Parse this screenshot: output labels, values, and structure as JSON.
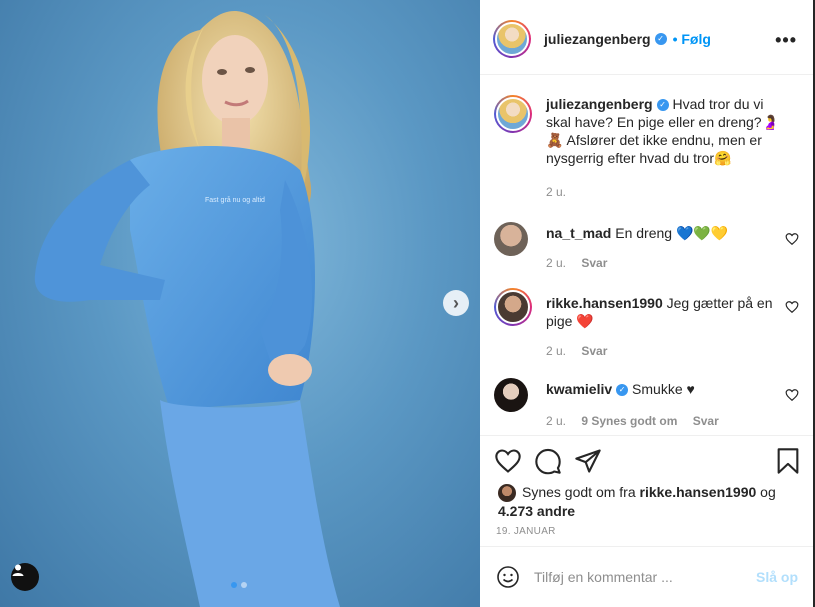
{
  "post": {
    "author": "juliezangenberg",
    "follow_label": "Følg",
    "more_icon": "•••",
    "caption": "Hvad tror du vi skal have? En pige eller en dreng?🤰🧸 Afslører det ikke endnu, men er nysgerrig efter hvad du tror🤗",
    "caption_time": "2 u.",
    "image_dots": {
      "total": 2,
      "active": 1
    }
  },
  "comments": [
    {
      "user": "na_t_mad",
      "text": "En dreng 💙💚💛",
      "time": "2 u.",
      "reply": "Svar",
      "likes": ""
    },
    {
      "user": "rikke.hansen1990",
      "text": "Jeg gætter på en pige ❤️",
      "time": "2 u.",
      "reply": "Svar",
      "likes": ""
    },
    {
      "user": "kwamieliv",
      "text": "Smukke ♥",
      "time": "2 u.",
      "reply": "Svar",
      "likes": "9 Synes godt om"
    }
  ],
  "likes": {
    "prefix": "Synes godt om fra",
    "user": "rikke.hansen1990",
    "connector": "og",
    "count": "4.273 andre"
  },
  "date": "19. JANUAR",
  "add_comment": {
    "placeholder": "Tilføj en kommentar ...",
    "post_label": "Slå op"
  },
  "colors": {
    "accent": "#0095f6",
    "verified": "#3897f0",
    "muted": "#8e8e8e",
    "post_disabled": "#b2dffc"
  }
}
